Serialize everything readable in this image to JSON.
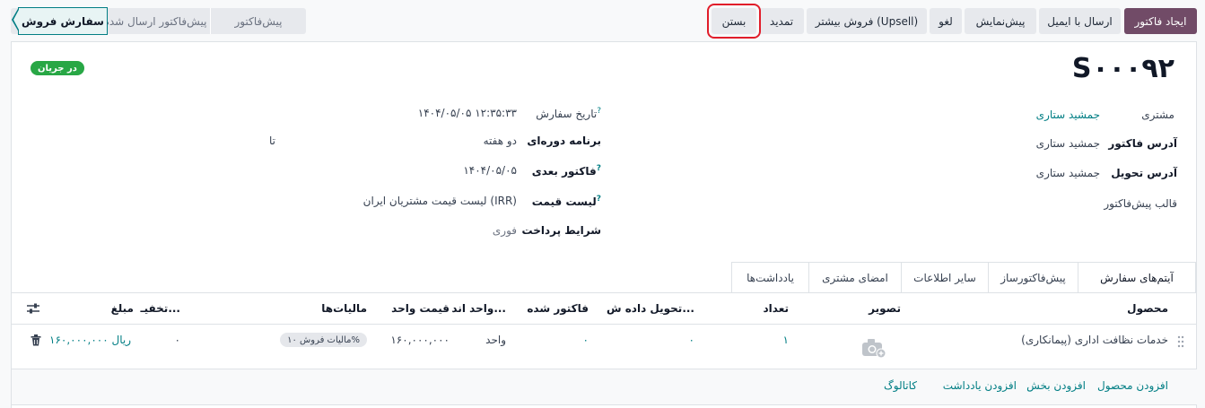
{
  "toolbar": {
    "create_invoice": "ایجاد فاکتور",
    "send_email": "ارسال با ایمیل",
    "preview": "پیش‌نمایش",
    "cancel": "لغو",
    "upsell": "فروش بیشتر (Upsell)",
    "renew": "تمدید",
    "close": "بستن"
  },
  "stages": {
    "sales_order": "سفارش فروش",
    "quotation_sent": "پیش‌فاکتور ارسال شده",
    "quotation": "پیش‌فاکتور"
  },
  "record": {
    "status_badge": "در جریان",
    "name": "S۰۰۰۹۲"
  },
  "fields_right": {
    "customer_label": "مشتری",
    "customer_value": "جمشید ستاری",
    "invoice_address_label": "آدرس فاکتور",
    "invoice_address_value": "جمشید ستاری",
    "delivery_address_label": "آدرس تحویل",
    "delivery_address_value": "جمشید ستاری",
    "quote_template_label": "قالب پیش‌فاکتور"
  },
  "fields_left": {
    "order_date_label": "تاریخ سفارش",
    "order_date_value": "۱۴۰۴/۰۵/۰۵ ۱۲:۳۵:۳۳",
    "recurring_plan_label": "برنامه دوره‌ای",
    "recurring_plan_value": "دو هفته",
    "recurring_plan_to": "تا",
    "next_invoice_label": "فاکتور بعدی",
    "next_invoice_value": "۱۴۰۴/۰۵/۰۵",
    "pricelist_label": "لیست قیمت",
    "pricelist_value": "لیست قیمت مشتریان ایران (IRR)",
    "payment_terms_label": "شرایط پرداخت",
    "payment_terms_value": "فوری"
  },
  "tabs": [
    "آیتم‌های سفارش",
    "پیش‌فاکتورساز",
    "سایر اطلاعات",
    "امضای مشتری",
    "یادداشت‌ها"
  ],
  "table": {
    "headers": {
      "product": "محصول",
      "image": "تصویر",
      "quantity": "تعداد",
      "delivered": "تحویل داده ش...",
      "invoiced": "فاکتور شده",
      "uom": "واحد اند...",
      "unit_price": "قیمت واحد",
      "taxes": "مالیات‌ها",
      "discount": "تخفیـ...",
      "amount": "مبلغ"
    },
    "rows": [
      {
        "product": "خدمات نظافت اداری (پیمانکاری)",
        "quantity": "۱",
        "delivered": "۰",
        "invoiced": "۰",
        "uom": "واحد",
        "unit_price": "۱۶۰,۰۰۰,۰۰۰",
        "tax": "مالیات فروش ۱۰%",
        "discount": "۰",
        "amount": "۱۶۰,۰۰۰,۰۰۰ ریال"
      }
    ],
    "add_links": {
      "add_product": "افزودن محصول",
      "add_section": "افزودن بخش",
      "add_note": "افزودن یادداشت",
      "catalog": "کاتالوگ"
    }
  },
  "colors": {
    "primary": "#714b67",
    "accent": "#017e84",
    "badge": "#28a745",
    "annotation": "#e11d2a"
  }
}
